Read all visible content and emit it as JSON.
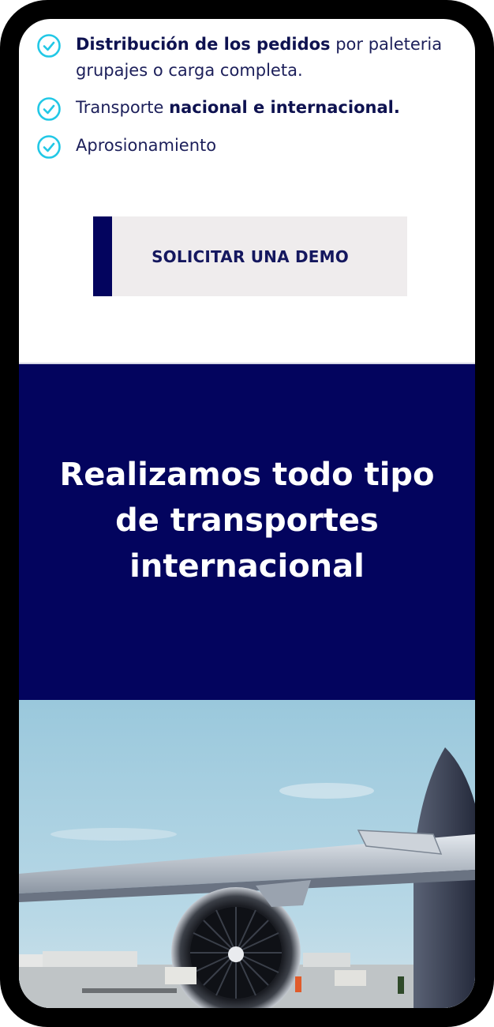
{
  "features": [
    {
      "bold": "Distribución de los pedidos",
      "rest": " por paleteria grupajes o carga completa.",
      "prefix": ""
    },
    {
      "prefix": "Transporte ",
      "bold": "nacional e internacional.",
      "rest": ""
    },
    {
      "prefix": "Aprosionamiento",
      "bold": "",
      "rest": ""
    }
  ],
  "cta": {
    "label": "SOLICITAR UNA DEMO"
  },
  "banner": {
    "title": "Realizamos todo tipo de transportes internacional"
  },
  "colors": {
    "navy": "#03045e",
    "check": "#22c8e6",
    "cta_bg": "#efeced",
    "text": "#1c1f5a"
  },
  "photo": {
    "subject": "airplane-engine-photo"
  }
}
